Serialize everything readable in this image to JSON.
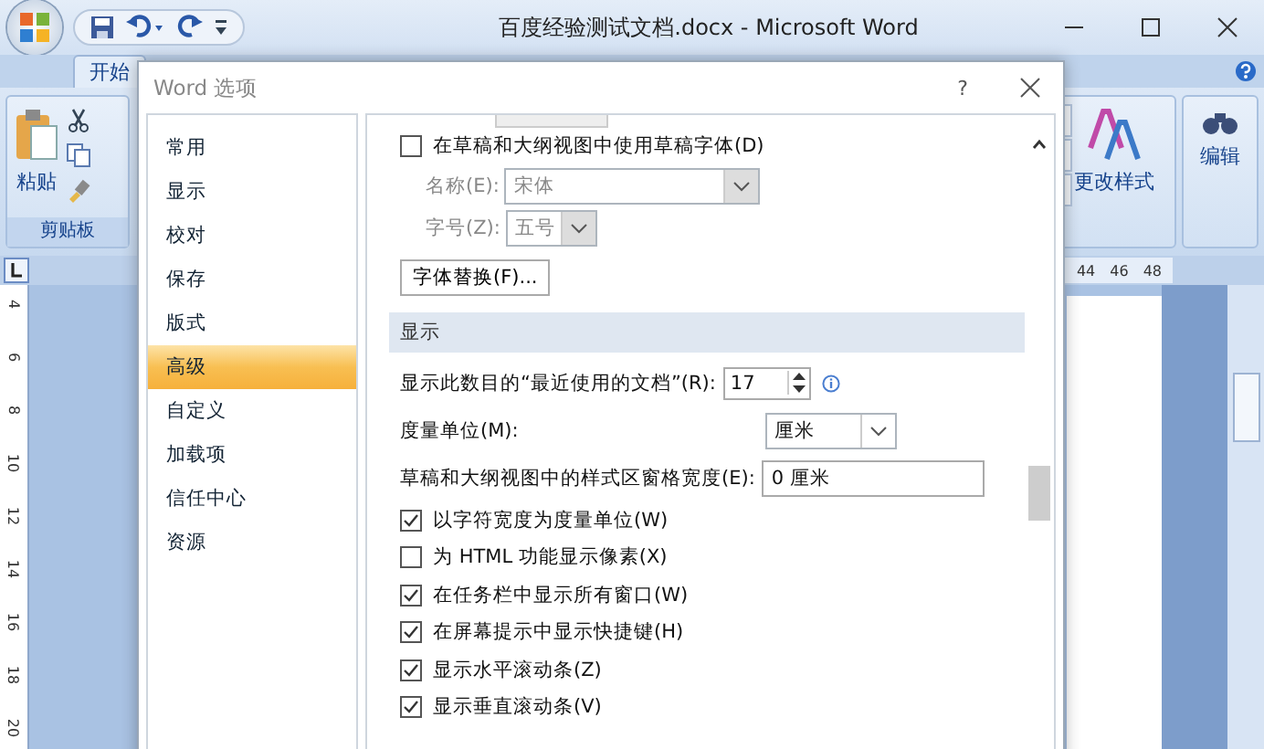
{
  "window": {
    "title": "百度经验测试文档.docx - Microsoft Word"
  },
  "ribbon_tabs": [
    {
      "label": "开始",
      "selected": true
    }
  ],
  "ribbon": {
    "paste": "粘贴",
    "clipboard_group": "剪贴板",
    "change_styles": "更改样式",
    "editing": "编辑"
  },
  "ruler": {
    "horizontal": [
      "44",
      "46",
      "48"
    ],
    "vertical": [
      "4",
      "6",
      "8",
      "10",
      "12",
      "14",
      "16",
      "18",
      "20"
    ]
  },
  "dialog": {
    "title": "Word 选项",
    "help": "?",
    "nav": [
      {
        "label": "常用",
        "selected": false
      },
      {
        "label": "显示",
        "selected": false
      },
      {
        "label": "校对",
        "selected": false
      },
      {
        "label": "保存",
        "selected": false
      },
      {
        "label": "版式",
        "selected": false
      },
      {
        "label": "高级",
        "selected": true
      },
      {
        "label": "自定义",
        "selected": false
      },
      {
        "label": "加载项",
        "selected": false
      },
      {
        "label": "信任中心",
        "selected": false
      },
      {
        "label": "资源",
        "selected": false
      }
    ],
    "settings": [
      {
        "kind": "checkbox",
        "label": "在草稿和大纲视图中使用草稿字体(D)",
        "checked": false
      },
      {
        "kind": "select",
        "label": "名称(E):",
        "value": "宋体",
        "disabled": true,
        "compact": false
      },
      {
        "kind": "select",
        "label": "字号(Z):",
        "value": "五号",
        "disabled": true,
        "compact": true
      },
      {
        "kind": "button",
        "label": "字体替换(F)..."
      },
      {
        "kind": "header",
        "label": "显示"
      },
      {
        "kind": "spin",
        "label": "显示此数目的“最近使用的文档”(R):",
        "value": "17"
      },
      {
        "kind": "select",
        "label": "度量单位(M):",
        "value": "厘米",
        "disabled": false,
        "compact": false
      },
      {
        "kind": "input",
        "label": "草稿和大纲视图中的样式区窗格宽度(E):",
        "value": "0 厘米"
      },
      {
        "kind": "checkbox",
        "label": "以字符宽度为度量单位(W)",
        "checked": true
      },
      {
        "kind": "checkbox",
        "label": "为 HTML 功能显示像素(X)",
        "checked": false
      },
      {
        "kind": "checkbox",
        "label": "在任务栏中显示所有窗口(W)",
        "checked": true
      },
      {
        "kind": "checkbox",
        "label": "在屏幕提示中显示快捷键(H)",
        "checked": true
      },
      {
        "kind": "checkbox",
        "label": "显示水平滚动条(Z)",
        "checked": true
      },
      {
        "kind": "checkbox",
        "label": "显示垂直滚动条(V)",
        "checked": true
      }
    ]
  }
}
